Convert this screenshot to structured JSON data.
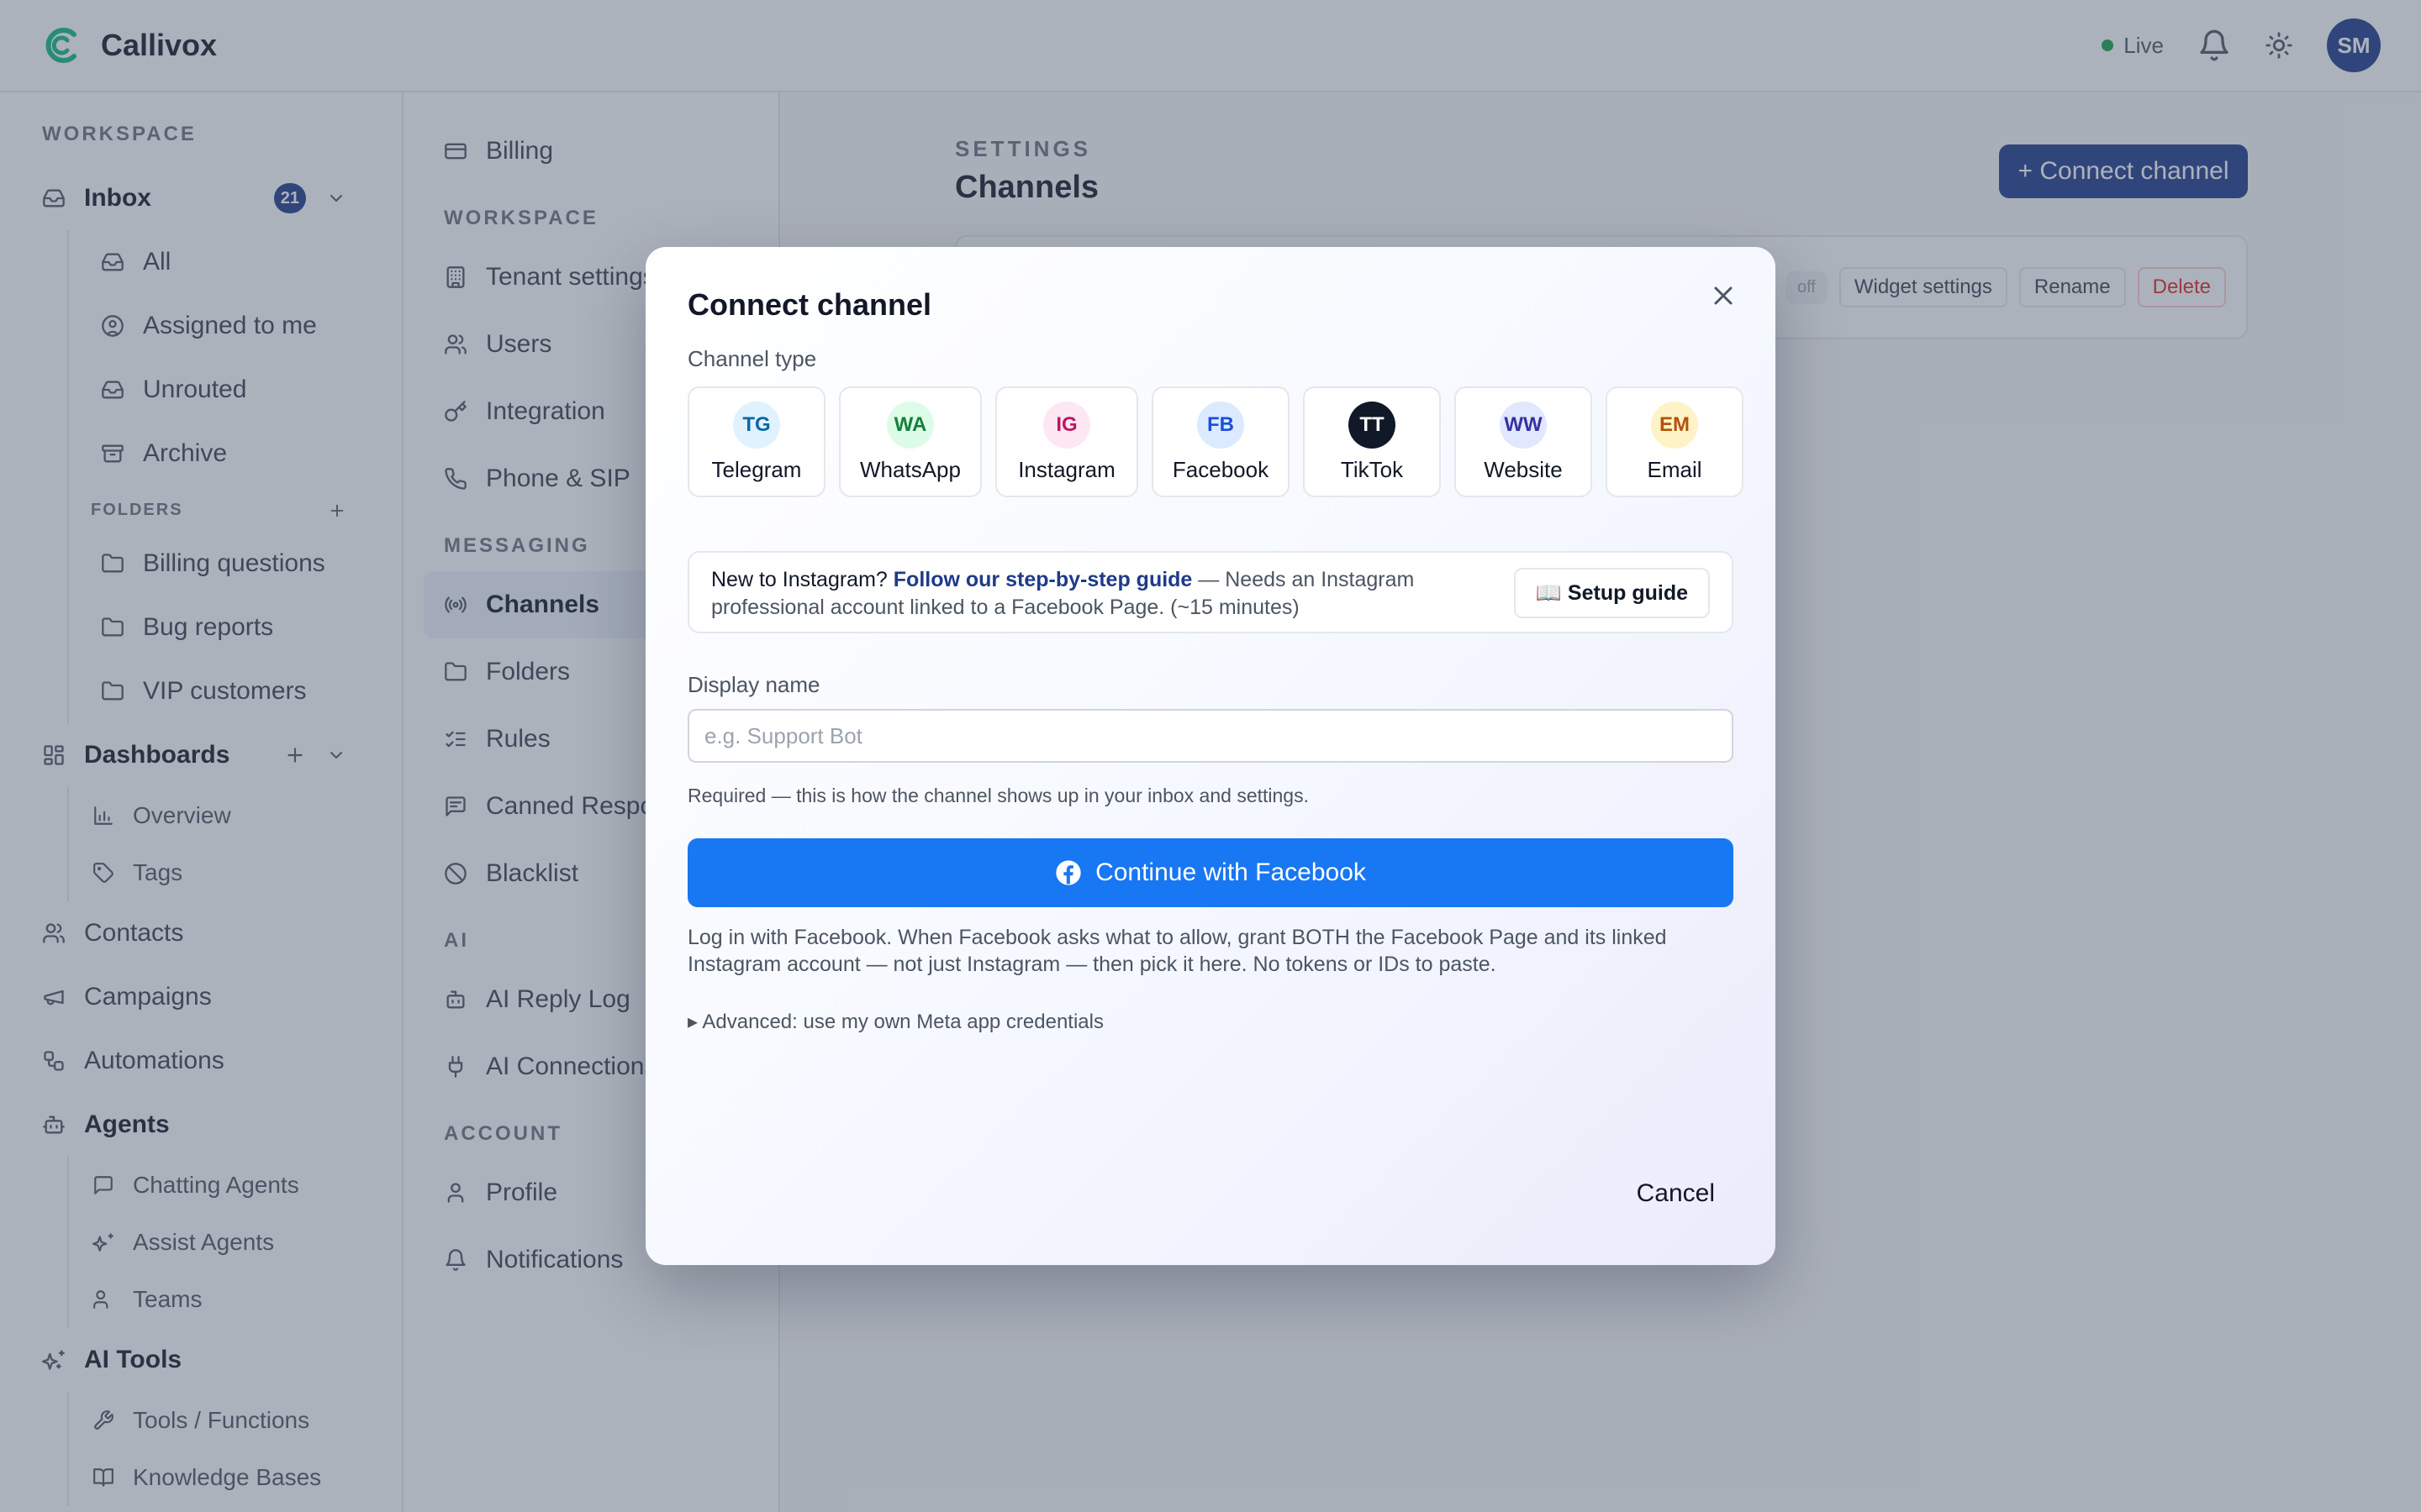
{
  "app": {
    "name": "Callivox"
  },
  "topbar": {
    "live_label": "Live",
    "avatar_initials": "SM"
  },
  "sidebar": {
    "workspace_label": "WORKSPACE",
    "inbox": {
      "label": "Inbox",
      "badge": "21"
    },
    "inbox_items": [
      "All",
      "Assigned to me",
      "Unrouted",
      "Archive"
    ],
    "folders_label": "FOLDERS",
    "folders": [
      "Billing questions",
      "Bug reports",
      "VIP customers"
    ],
    "dashboards": {
      "label": "Dashboards",
      "items": [
        "Overview",
        "Tags"
      ]
    },
    "contacts": "Contacts",
    "campaigns": "Campaigns",
    "automations": "Automations",
    "agents": {
      "label": "Agents",
      "items": [
        "Chatting Agents",
        "Assist Agents",
        "Teams"
      ]
    },
    "ai_tools": {
      "label": "AI Tools",
      "items": [
        "Tools / Functions",
        "Knowledge Bases"
      ]
    }
  },
  "settings_nav": {
    "billing": "Billing",
    "workspace_label": "WORKSPACE",
    "workspace_items": [
      "Tenant settings",
      "Users",
      "Integration",
      "Phone & SIP"
    ],
    "messaging_label": "MESSAGING",
    "messaging_items": [
      "Channels",
      "Folders",
      "Rules",
      "Canned Responses",
      "Blacklist"
    ],
    "ai_label": "AI",
    "ai_items": [
      "AI Reply Log",
      "AI Connections"
    ],
    "account_label": "ACCOUNT",
    "account_items": [
      "Profile",
      "Notifications"
    ]
  },
  "main": {
    "eyebrow": "SETTINGS",
    "title": "Channels",
    "connect_button": "+ Connect channel",
    "card_status": "off",
    "card_actions": [
      "Widget settings",
      "Rename",
      "Delete"
    ]
  },
  "modal": {
    "title": "Connect channel",
    "channel_type_label": "Channel type",
    "channel_types": [
      {
        "abbr": "TG",
        "name": "Telegram",
        "bg": "#e0f2fe",
        "fg": "#0369a1"
      },
      {
        "abbr": "WA",
        "name": "WhatsApp",
        "bg": "#dcfce7",
        "fg": "#15803d"
      },
      {
        "abbr": "IG",
        "name": "Instagram",
        "bg": "#fce7f3",
        "fg": "#be185d"
      },
      {
        "abbr": "FB",
        "name": "Facebook",
        "bg": "#dbeafe",
        "fg": "#1d4ed8"
      },
      {
        "abbr": "TT",
        "name": "TikTok",
        "bg": "#111827",
        "fg": "#ffffff"
      },
      {
        "abbr": "WW",
        "name": "Website",
        "bg": "#e0e7ff",
        "fg": "#3730a3"
      },
      {
        "abbr": "EM",
        "name": "Email",
        "bg": "#fef3c7",
        "fg": "#b45309"
      }
    ],
    "guide": {
      "lead": "New to Instagram?",
      "link": "Follow our step-by-step guide",
      "rest": " — Needs an Instagram professional account linked to a Facebook Page. (~15 minutes)",
      "button": "📖 Setup guide"
    },
    "display_name_label": "Display name",
    "display_name_placeholder": "e.g. Support Bot",
    "display_name_value": "",
    "hint": "Required — this is how the channel shows up in your inbox and settings.",
    "fb_button": "Continue with Facebook",
    "fb_note": "Log in with Facebook. When Facebook asks what to allow, grant BOTH the Facebook Page and its linked Instagram account — not just Instagram — then pick it here. No tokens or IDs to paste.",
    "advanced": "▸ Advanced: use my own Meta app credentials",
    "cancel": "Cancel"
  },
  "colors": {
    "brand": "#1e3a8a",
    "facebook": "#1877f2",
    "logo": "#10b981"
  }
}
